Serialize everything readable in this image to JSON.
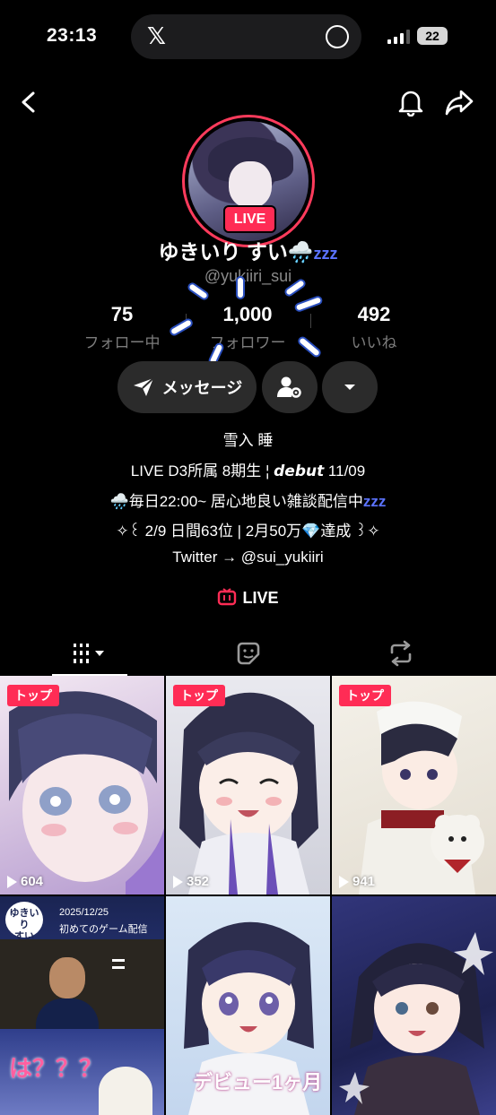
{
  "status_bar": {
    "time": "23:13",
    "battery": "22"
  },
  "profile": {
    "live_badge": "LIVE",
    "name": "ゆきいり すい🌧️",
    "name_suffix": "zzz",
    "handle": "@yukiiri_sui"
  },
  "stats": [
    {
      "value": "75",
      "label": "フォロー中"
    },
    {
      "value": "1,000",
      "label": "フォロワー"
    },
    {
      "value": "492",
      "label": "いいね"
    }
  ],
  "actions": {
    "message_label": "メッセージ"
  },
  "bio": {
    "line1": "雪入 睡",
    "line2": "LIVE D3所属 8期生 ¦ 𝙙𝙚𝙗𝙪𝙩 11/09",
    "line3": "🌧️毎日22:00~ 居心地良い雑談配信中",
    "line3_suffix": "zzz",
    "line4": "✧꒰ 2/9 日間63位 | 2月50万💎達成 ꒱✧",
    "line5": "Twitter → @sui_yukiiri"
  },
  "live_link": "LIVE",
  "grid": [
    {
      "tag": "トップ",
      "views": "604"
    },
    {
      "tag": "トップ",
      "views": "352"
    },
    {
      "tag": "トップ",
      "views": "941"
    },
    {
      "tag": "",
      "views": ""
    },
    {
      "tag": "",
      "views": ""
    },
    {
      "tag": "",
      "views": ""
    }
  ],
  "thumb_texts": {
    "t4_top": "2025/12/25",
    "t4_sub": "初めてのゲーム配信",
    "t4_bottom": "は？？？",
    "t5_bottom": "デビュー1ヶ月"
  },
  "colors": {
    "accent": "#ff2c55",
    "zzz": "#5b73ff",
    "muted": "#7c7c7c"
  }
}
